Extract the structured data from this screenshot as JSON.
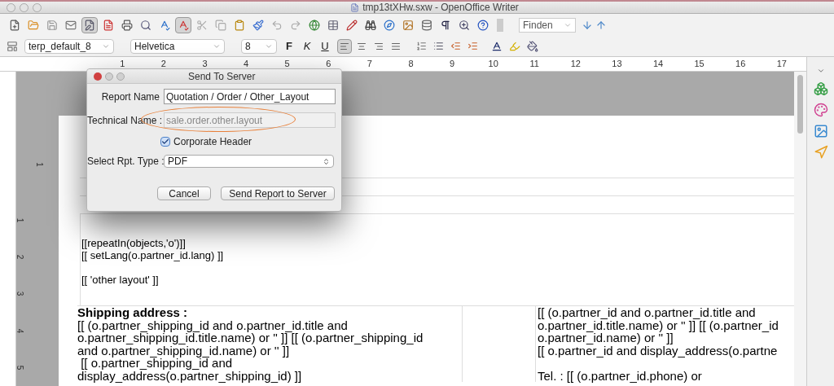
{
  "window": {
    "title": "tmp13tXHw.sxw - OpenOffice Writer"
  },
  "toolbar_standard": {
    "buttons": [
      {
        "kind": "new",
        "selected": false
      },
      {
        "kind": "open",
        "selected": false
      },
      {
        "kind": "save",
        "selected": false
      },
      {
        "kind": "mail",
        "selected": false
      },
      {
        "kind": "edit",
        "selected": true
      },
      {
        "kind": "pdf",
        "selected": false
      },
      {
        "kind": "print",
        "selected": false
      },
      {
        "kind": "preview",
        "selected": false
      },
      {
        "kind": "spell",
        "selected": false
      },
      {
        "kind": "autospell",
        "selected": true
      },
      {
        "kind": "cut",
        "selected": false
      },
      {
        "kind": "copy",
        "selected": false
      },
      {
        "kind": "paste",
        "selected": false
      },
      {
        "kind": "brush",
        "selected": false
      },
      {
        "kind": "undo",
        "selected": false
      },
      {
        "kind": "redo",
        "selected": false
      },
      {
        "kind": "globe",
        "selected": false
      },
      {
        "kind": "table",
        "selected": false
      },
      {
        "kind": "draw",
        "selected": false
      },
      {
        "kind": "binoculars",
        "selected": false
      },
      {
        "kind": "compass",
        "selected": false
      },
      {
        "kind": "image",
        "selected": false
      },
      {
        "kind": "database",
        "selected": false
      },
      {
        "kind": "pilcrow",
        "selected": false
      },
      {
        "kind": "zoom",
        "selected": false
      },
      {
        "kind": "help",
        "selected": false
      }
    ],
    "find_field": {
      "value": "Finden"
    }
  },
  "toolbar_formatting": {
    "style": "terp_default_8",
    "font": "Helvetica",
    "size": "8",
    "text_buttons": [
      {
        "label": "F",
        "kind": "bold"
      },
      {
        "label": "K",
        "kind": "italic"
      },
      {
        "label": "U",
        "kind": "underline"
      }
    ],
    "align_buttons": [
      {
        "kind": "left",
        "selected": true
      },
      {
        "kind": "center",
        "selected": false
      },
      {
        "kind": "right",
        "selected": false
      },
      {
        "kind": "justify",
        "selected": false
      }
    ]
  },
  "ruler": {
    "marks": [
      "1",
      "2",
      "3",
      "4",
      "5",
      "6",
      "7",
      "8",
      "9",
      "10",
      "11",
      "12",
      "13",
      "14",
      "15",
      "16",
      "17"
    ],
    "vertical_marks": [
      "1",
      "1",
      "2",
      "3",
      "4",
      "5"
    ]
  },
  "document": {
    "paragraphs": [
      [
        "[[repeatIn(objects,'o')]]",
        "[[ setLang(o.partner_id.lang) ]]"
      ],
      [
        "[[ 'other layout' ]]"
      ]
    ],
    "table": {
      "left_title": "Shipping address :",
      "left_lines": [
        "[[ (o.partner_shipping_id and o.partner_id.title and",
        "o.partner_shipping_id.title.name) or '' ]] [[ (o.partner_shipping_id",
        "and o.partner_shipping_id.name) or '' ]]",
        " [[ o.partner_shipping_id and",
        "display_address(o.partner_shipping_id) ]]"
      ],
      "right_paragraphs": [
        [
          "[[ (o.partner_id and o.partner_id.title and",
          "o.partner_id.title.name) or '' ]] [[ (o.partner_id",
          "o.partner_id.name) or '' ]]",
          "[[ o.partner_id and display_address(o.partne"
        ],
        [
          "Tel. : [[ (o.partner_id.phone) or"
        ]
      ]
    }
  },
  "dialog": {
    "title": "Send To Server",
    "report_name": {
      "label": "Report Name",
      "value": "Quotation / Order / Other_Layout"
    },
    "technical_name": {
      "label": "Technical Name :",
      "placeholder": "sale.order.other.layout",
      "highlighted": true
    },
    "corporate_header": {
      "label": "Corporate Header",
      "checked": true
    },
    "report_type": {
      "label": "Select Rpt. Type :",
      "value": "PDF"
    },
    "buttons": [
      "Cancel",
      "Send Report to Server"
    ]
  }
}
